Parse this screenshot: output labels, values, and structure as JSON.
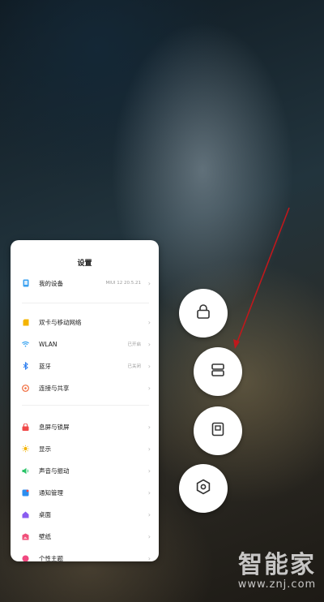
{
  "settings": {
    "title": "设置",
    "items": [
      {
        "label": "我的设备",
        "value": "MIUI 12 20.5.21",
        "icon": "phone-icon",
        "color": "#3aa0f0"
      },
      {
        "label": "双卡与移动网络",
        "value": "",
        "icon": "sim-card-icon",
        "color": "#f4b400"
      },
      {
        "label": "WLAN",
        "value": "已开启",
        "icon": "wifi-icon",
        "color": "#2c9ef0"
      },
      {
        "label": "蓝牙",
        "value": "已关闭",
        "icon": "bluetooth-icon",
        "color": "#2c7ef0"
      },
      {
        "label": "连接与共享",
        "value": "",
        "icon": "connection-icon",
        "color": "#f06a3a"
      },
      {
        "label": "息屏与锁屏",
        "value": "",
        "icon": "lock-screen-icon",
        "color": "#f04848"
      },
      {
        "label": "显示",
        "value": "",
        "icon": "sun-icon",
        "color": "#f4b400"
      },
      {
        "label": "声音与振动",
        "value": "",
        "icon": "speaker-icon",
        "color": "#2cc46a"
      },
      {
        "label": "通知管理",
        "value": "",
        "icon": "notification-icon",
        "color": "#2c8ef0"
      },
      {
        "label": "桌面",
        "value": "",
        "icon": "home-icon",
        "color": "#8a5cf0"
      },
      {
        "label": "壁纸",
        "value": "",
        "icon": "wallpaper-icon",
        "color": "#f0507a"
      },
      {
        "label": "个性主题",
        "value": "",
        "icon": "theme-icon",
        "color": "#f04880"
      }
    ]
  },
  "quick_actions": [
    {
      "name": "lock-app-button",
      "icon": "lock-icon"
    },
    {
      "name": "split-screen-button",
      "icon": "split-screen-icon"
    },
    {
      "name": "floating-window-button",
      "icon": "floating-window-icon"
    },
    {
      "name": "app-settings-button",
      "icon": "hexagon-settings-icon"
    }
  ],
  "watermark": {
    "main": "智能家",
    "sub": "www.znj.com"
  },
  "colors": {
    "arrow": "#c0181c",
    "card_bg": "#ffffff"
  }
}
